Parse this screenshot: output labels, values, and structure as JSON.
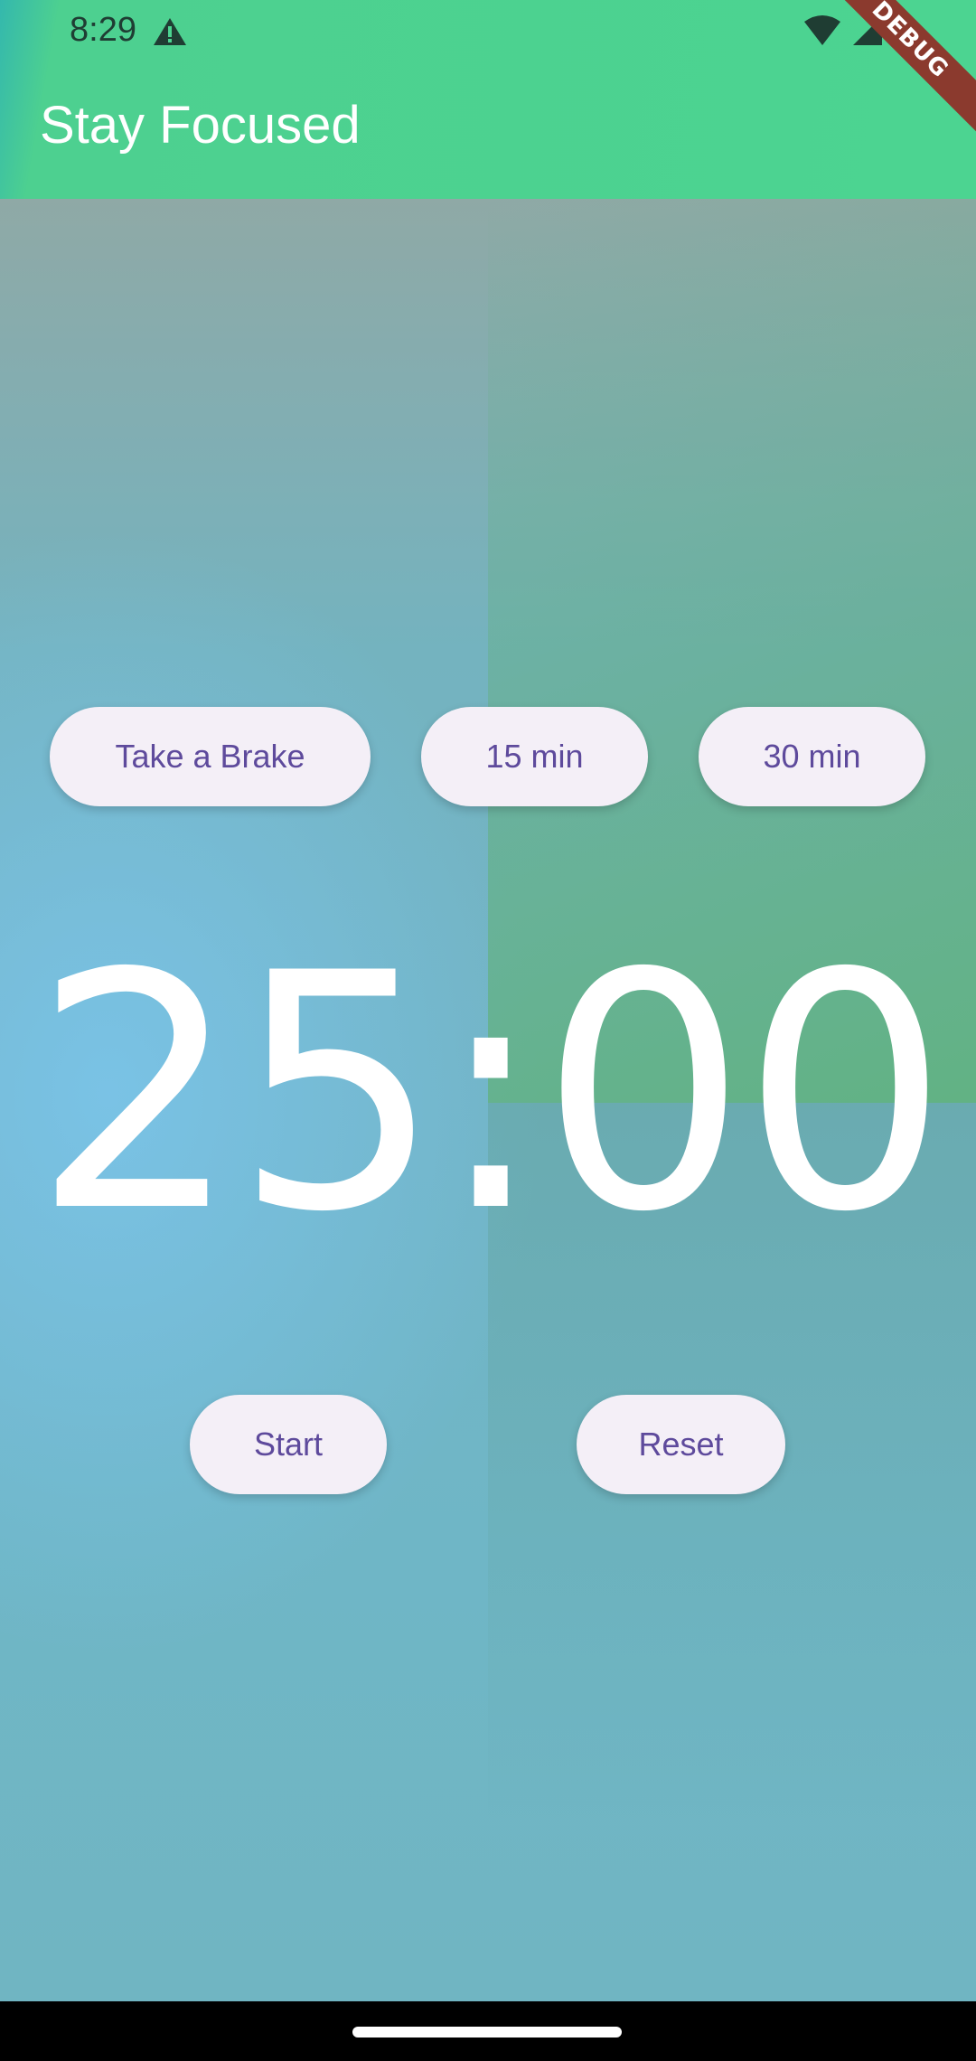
{
  "status_bar": {
    "time": "8:29",
    "warning_icon": "warning-triangle-icon",
    "icons": [
      "wifi-icon",
      "signal-icon",
      "battery-icon"
    ]
  },
  "debug_banner": "DEBUG",
  "app_bar": {
    "title": "Stay Focused"
  },
  "mode_buttons": {
    "break_label": "Take a Brake",
    "fifteen_label": "15 min",
    "thirty_label": "30 min"
  },
  "timer": {
    "display": "25:00"
  },
  "controls": {
    "start_label": "Start",
    "reset_label": "Reset"
  },
  "colors": {
    "app_bar": "#4cd491",
    "button_bg": "#f4eff7",
    "button_text": "#5e4a9c",
    "timer_text": "#ffffff"
  }
}
